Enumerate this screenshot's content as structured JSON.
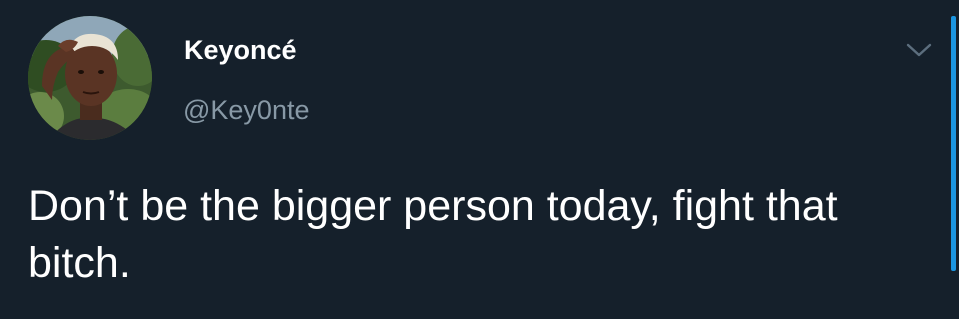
{
  "tweet": {
    "display_name": "Keyoncé",
    "handle": "@Key0nte",
    "text": "Don’t be the bigger person today, fight that bitch."
  },
  "icons": {
    "menu": "chevron-down-icon",
    "avatar": "profile-photo"
  },
  "colors": {
    "background": "#15202b",
    "name": "#ffffff",
    "handle": "#8899a6",
    "accent": "#1b95e0"
  }
}
